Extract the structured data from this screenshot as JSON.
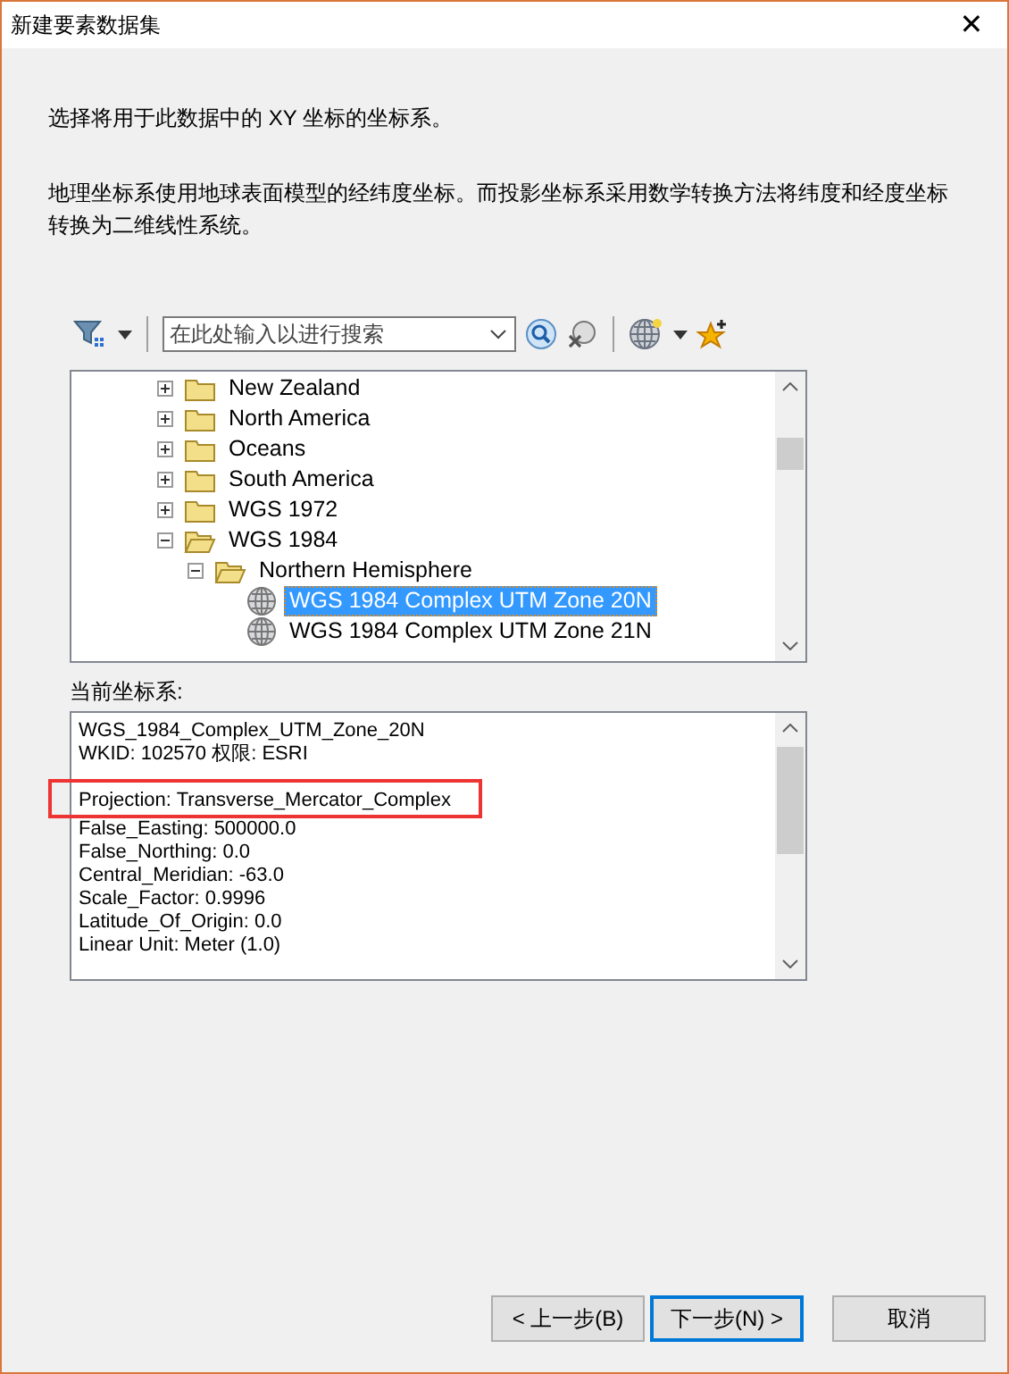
{
  "window": {
    "title": "新建要素数据集",
    "close": "✕"
  },
  "intro": "选择将用于此数据中的 XY 坐标的坐标系。",
  "description": "地理坐标系使用地球表面模型的经纬度坐标。而投影坐标系采用数学转换方法将纬度和经度坐标转换为二维线性系统。",
  "search": {
    "placeholder": "在此处输入以进行搜索"
  },
  "tree": [
    {
      "kind": "folder",
      "label": "New Zealand",
      "expanded": false
    },
    {
      "kind": "folder",
      "label": "North America",
      "expanded": false
    },
    {
      "kind": "folder",
      "label": "Oceans",
      "expanded": false
    },
    {
      "kind": "folder",
      "label": "South America",
      "expanded": false
    },
    {
      "kind": "folder",
      "label": "WGS 1972",
      "expanded": false
    },
    {
      "kind": "folder",
      "label": "WGS 1984",
      "expanded": true,
      "children": [
        {
          "kind": "folder",
          "label": "Northern Hemisphere",
          "expanded": true,
          "children": [
            {
              "kind": "system",
              "label": "WGS 1984 Complex UTM Zone 20N",
              "selected": true
            },
            {
              "kind": "system",
              "label": "WGS 1984 Complex UTM Zone 21N",
              "selected": false
            }
          ]
        }
      ]
    }
  ],
  "current_label": "当前坐标系:",
  "details": {
    "header": [
      "WGS_1984_Complex_UTM_Zone_20N",
      "WKID: 102570 权限: ESRI"
    ],
    "parameters": [
      {
        "text": "Projection: Transverse_Mercator_Complex",
        "highlighted": true
      },
      {
        "text": "False_Easting: 500000.0",
        "highlighted": false
      },
      {
        "text": "False_Northing: 0.0",
        "highlighted": false
      },
      {
        "text": "Central_Meridian: -63.0",
        "highlighted": false
      },
      {
        "text": "Scale_Factor: 0.9996",
        "highlighted": false
      },
      {
        "text": "Latitude_Of_Origin: 0.0",
        "highlighted": false
      },
      {
        "text": "Linear Unit: Meter (1.0)",
        "highlighted": false
      }
    ]
  },
  "buttons": [
    {
      "label": "< 上一步(B)",
      "default": false
    },
    {
      "label": "下一步(N) >",
      "default": true
    },
    {
      "label": "取消",
      "default": false
    }
  ]
}
